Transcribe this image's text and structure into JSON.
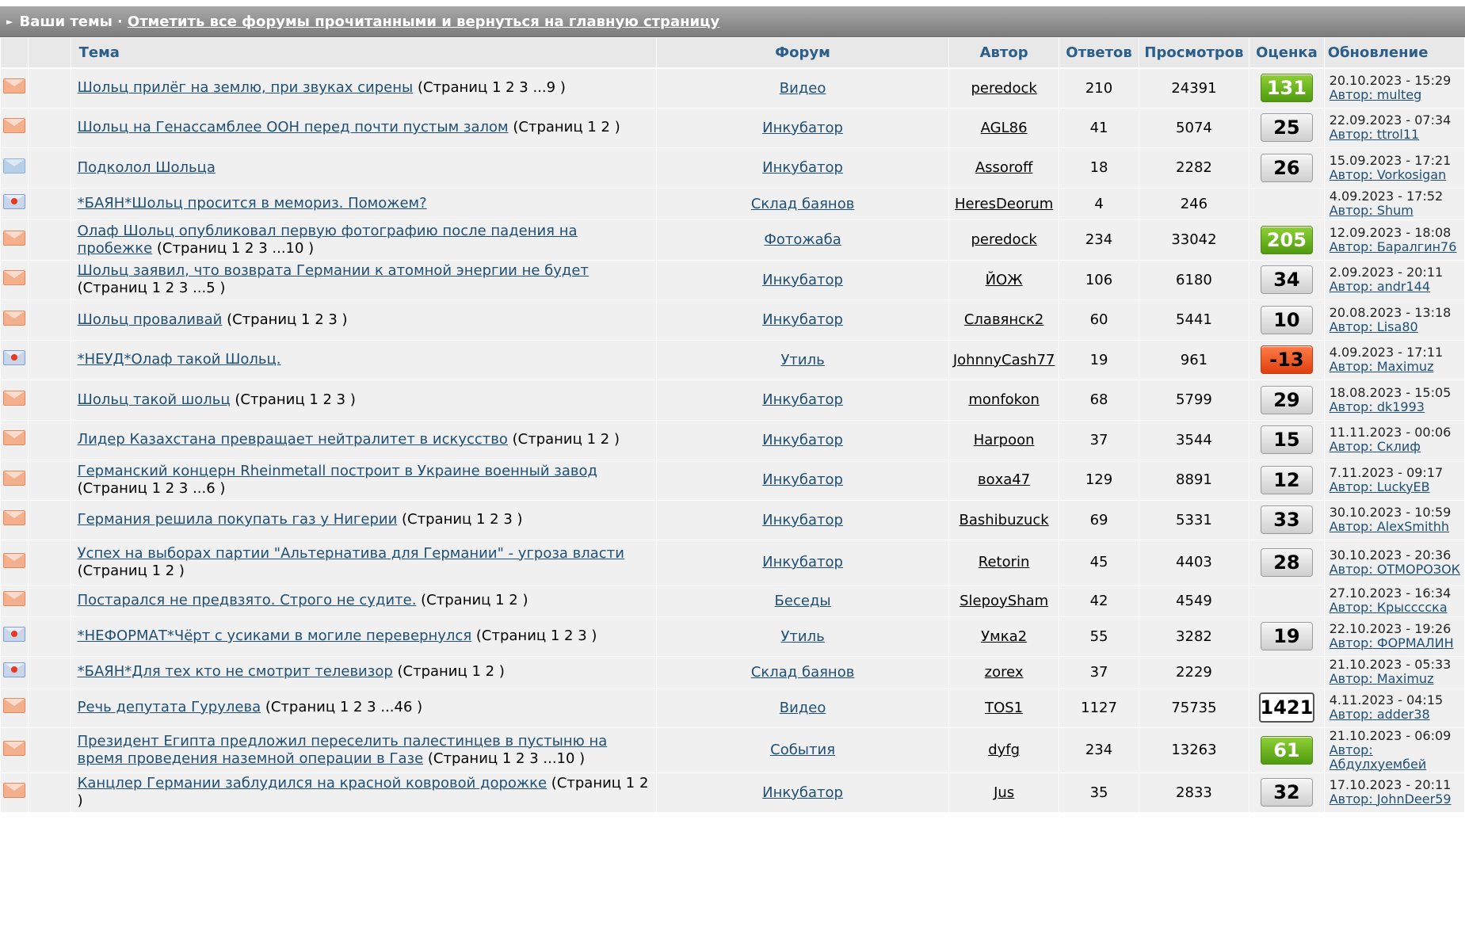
{
  "header": {
    "label": "Ваши темы",
    "separator": "·",
    "link": "Отметить все форумы прочитанными и вернуться на главную страницу"
  },
  "columns": {
    "topic": "Тема",
    "forum": "Форум",
    "author": "Автор",
    "replies": "Ответов",
    "views": "Просмотров",
    "rating": "Оценка",
    "update": "Обновление"
  },
  "rows": [
    {
      "icon": "mail-icon",
      "title": "Шольц прилёг на землю, при звуках сирены",
      "pages": "(Страниц 1 2 3 ...9 )",
      "forum": "Видео",
      "author": "peredock",
      "replies": "210",
      "views": "24391",
      "rating": "131",
      "rating_style": "green",
      "date": "20.10.2023 - 15:29",
      "by": "Автор:",
      "last": "multeg"
    },
    {
      "icon": "mail-icon",
      "title": "Шольц на Генассамблее ООН перед почти пустым залом",
      "pages": "(Страниц 1 2 )",
      "forum": "Инкубатор",
      "author": "AGL86",
      "replies": "41",
      "views": "5074",
      "rating": "25",
      "rating_style": "gray",
      "date": "22.09.2023 - 07:34",
      "by": "Автор:",
      "last": "ttrol11"
    },
    {
      "icon": "mail-blue-icon",
      "title": "Подколол Шольца",
      "pages": "",
      "forum": "Инкубатор",
      "author": "Assoroff",
      "replies": "18",
      "views": "2282",
      "rating": "26",
      "rating_style": "gray",
      "date": "15.09.2023 - 17:21",
      "by": "Автор:",
      "last": "Vorkosigan"
    },
    {
      "icon": "moved-icon",
      "title": "*БАЯН*Шольц просится в мемориз. Поможем?",
      "pages": "",
      "forum": "Склад баянов",
      "author": "HeresDeorum",
      "replies": "4",
      "views": "246",
      "rating": "",
      "rating_style": "none",
      "date": "4.09.2023 - 17:52",
      "by": "Автор:",
      "last": "Shum"
    },
    {
      "icon": "mail-icon",
      "title": "Олаф Шольц опубликовал первую фотографию после падения на пробежке",
      "pages": "(Страниц 1 2 3 ...10 )",
      "forum": "Фотожаба",
      "author": "peredock",
      "replies": "234",
      "views": "33042",
      "rating": "205",
      "rating_style": "green",
      "date": "12.09.2023 - 18:08",
      "by": "Автор:",
      "last": "Баралгин76"
    },
    {
      "icon": "mail-icon",
      "title": "Шольц заявил, что возврата Германии к атомной энергии не будет",
      "pages": "(Страниц 1 2 3 ...5 )",
      "forum": "Инкубатор",
      "author": "ЙОЖ",
      "replies": "106",
      "views": "6180",
      "rating": "34",
      "rating_style": "gray",
      "date": "2.09.2023 - 20:11",
      "by": "Автор:",
      "last": "andr144"
    },
    {
      "icon": "mail-icon",
      "title": "Шольц проваливай",
      "pages": "(Страниц 1 2 3 )",
      "forum": "Инкубатор",
      "author": "Славянск2",
      "replies": "60",
      "views": "5441",
      "rating": "10",
      "rating_style": "gray",
      "date": "20.08.2023 - 13:18",
      "by": "Автор:",
      "last": "Lisa80"
    },
    {
      "icon": "moved-icon",
      "title": "*НЕУД*Олаф такой Шольц.",
      "pages": "",
      "forum": "Утиль",
      "author": "JohnnyCash77",
      "replies": "19",
      "views": "961",
      "rating": "-13",
      "rating_style": "red",
      "date": "4.09.2023 - 17:11",
      "by": "Автор:",
      "last": "Maximuz"
    },
    {
      "icon": "mail-icon",
      "title": "Шольц такой шольц",
      "pages": "(Страниц 1 2 3 )",
      "forum": "Инкубатор",
      "author": "monfokon",
      "replies": "68",
      "views": "5799",
      "rating": "29",
      "rating_style": "gray",
      "date": "18.08.2023 - 15:05",
      "by": "Автор:",
      "last": "dk1993"
    },
    {
      "icon": "mail-icon",
      "title": "Лидер Казахстана превращает нейтралитет в искусство",
      "pages": "(Страниц 1 2 )",
      "forum": "Инкубатор",
      "author": "Harpoon",
      "replies": "37",
      "views": "3544",
      "rating": "15",
      "rating_style": "gray",
      "date": "11.11.2023 - 00:06",
      "by": "Автор:",
      "last": "Склиф"
    },
    {
      "icon": "mail-icon",
      "title": "Германский концерн Rheinmetall построит в Украине военный завод",
      "pages": "(Страниц 1 2 3 ...6 )",
      "forum": "Инкубатор",
      "author": "воха47",
      "replies": "129",
      "views": "8891",
      "rating": "12",
      "rating_style": "gray",
      "date": "7.11.2023 - 09:17",
      "by": "Автор:",
      "last": "LuckyEB"
    },
    {
      "icon": "mail-icon",
      "title": "Германия решила покупать газ у Нигерии",
      "pages": "(Страниц 1 2 3 )",
      "forum": "Инкубатор",
      "author": "Bashibuzuck",
      "replies": "69",
      "views": "5331",
      "rating": "33",
      "rating_style": "gray",
      "date": "30.10.2023 - 10:59",
      "by": "Автор:",
      "last": "AlexSmithh"
    },
    {
      "icon": "mail-icon",
      "title": "Успех на выборах партии \"Альтернатива для Германии\" - угроза власти",
      "pages": "(Страниц 1 2 )",
      "forum": "Инкубатор",
      "author": "Retorin",
      "replies": "45",
      "views": "4403",
      "rating": "28",
      "rating_style": "gray",
      "date": "30.10.2023 - 20:36",
      "by": "Автор:",
      "last": "ОТМОРОЗОК"
    },
    {
      "icon": "mail-icon",
      "title": "Постарался не предвзято. Строго не судите.",
      "pages": "(Страниц 1 2 )",
      "forum": "Беседы",
      "author": "SlepoySham",
      "replies": "42",
      "views": "4549",
      "rating": "",
      "rating_style": "none",
      "date": "27.10.2023 - 16:34",
      "by": "Автор:",
      "last": "Крысссска"
    },
    {
      "icon": "moved-icon",
      "title": "*НЕФОРМАТ*Чёрт с усиками в могиле перевернулся",
      "pages": "(Страниц 1 2 3 )",
      "forum": "Утиль",
      "author": "Умка2",
      "replies": "55",
      "views": "3282",
      "rating": "19",
      "rating_style": "gray",
      "date": "22.10.2023 - 19:26",
      "by": "Автор:",
      "last": "ФОРМАЛИН"
    },
    {
      "icon": "moved-icon",
      "title": "*БАЯН*Для тех кто не смотрит телевизор",
      "pages": "(Страниц 1 2 )",
      "forum": "Склад баянов",
      "author": "zorex",
      "replies": "37",
      "views": "2229",
      "rating": "",
      "rating_style": "none",
      "date": "21.10.2023 - 05:33",
      "by": "Автор:",
      "last": "Maximuz"
    },
    {
      "icon": "mail-icon",
      "title": "Речь депутата Гурулева",
      "pages": "(Страниц 1 2 3 ...46 )",
      "forum": "Видео",
      "author": "TOS1",
      "replies": "1127",
      "views": "75735",
      "rating": "1421",
      "rating_style": "white",
      "date": "4.11.2023 - 04:15",
      "by": "Автор:",
      "last": "adder38"
    },
    {
      "icon": "mail-icon",
      "title": "Президент Египта предложил переселить палестинцев в пустыню на время проведения наземной операции в Газе",
      "pages": "(Страниц 1 2 3 ...10 )",
      "forum": "События",
      "author": "dyfg",
      "replies": "234",
      "views": "13263",
      "rating": "61",
      "rating_style": "green",
      "date": "21.10.2023 - 06:09",
      "by": "Автор:",
      "last": "Абдулхуембей"
    },
    {
      "icon": "mail-icon",
      "title": "Канцлер Германии заблудился на красной ковровой дорожке",
      "pages": "(Страниц 1 2 )",
      "forum": "Инкубатор",
      "author": "Jus",
      "replies": "35",
      "views": "2833",
      "rating": "32",
      "rating_style": "gray",
      "date": "17.10.2023 - 20:11",
      "by": "Автор:",
      "last": "JohnDeer59"
    }
  ]
}
